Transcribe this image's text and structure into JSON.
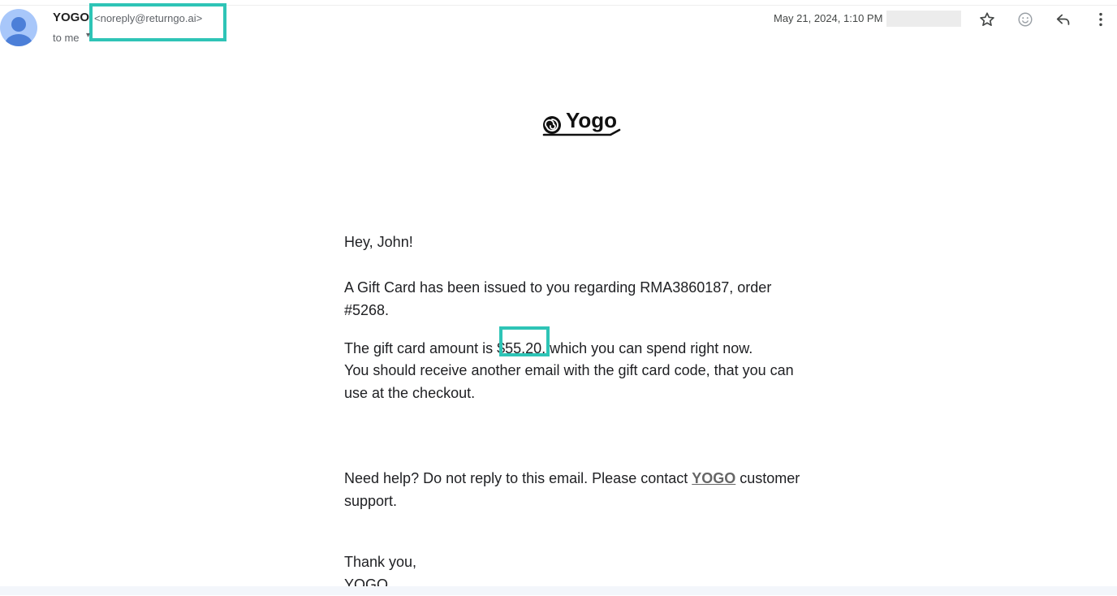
{
  "header": {
    "sender_name": "YOGO",
    "sender_email": "<noreply@returngo.ai>",
    "recipient": "to me",
    "date": "May 21, 2024, 1:10 PM",
    "icons": [
      "star-icon",
      "emoji-icon",
      "reply-icon",
      "more-vert-icon"
    ]
  },
  "logo": {
    "text": "Yogo"
  },
  "body": {
    "greeting": "Hey, John!",
    "issued_line1": "A Gift Card has been issued to you regarding RMA3860187, order",
    "issued_line2": "#5268.",
    "amount_prefix": "The gift card amount is ",
    "amount": "$55.20",
    "amount_suffix": ", which you can spend right now.",
    "receive_line1": "You should receive another email with the gift card code, that you can",
    "receive_line2": "use at the checkout.",
    "help_prefix": "Need help? Do not reply to this email. Please contact ",
    "help_link": "YOGO",
    "help_suffix": " customer",
    "help_line2": "support.",
    "thanks": "Thank you,",
    "signature": "YOGO"
  },
  "colors": {
    "highlight": "#2ec4b6",
    "avatar_bg": "#a8c7fa",
    "avatar_fg": "#4c7fd8"
  }
}
